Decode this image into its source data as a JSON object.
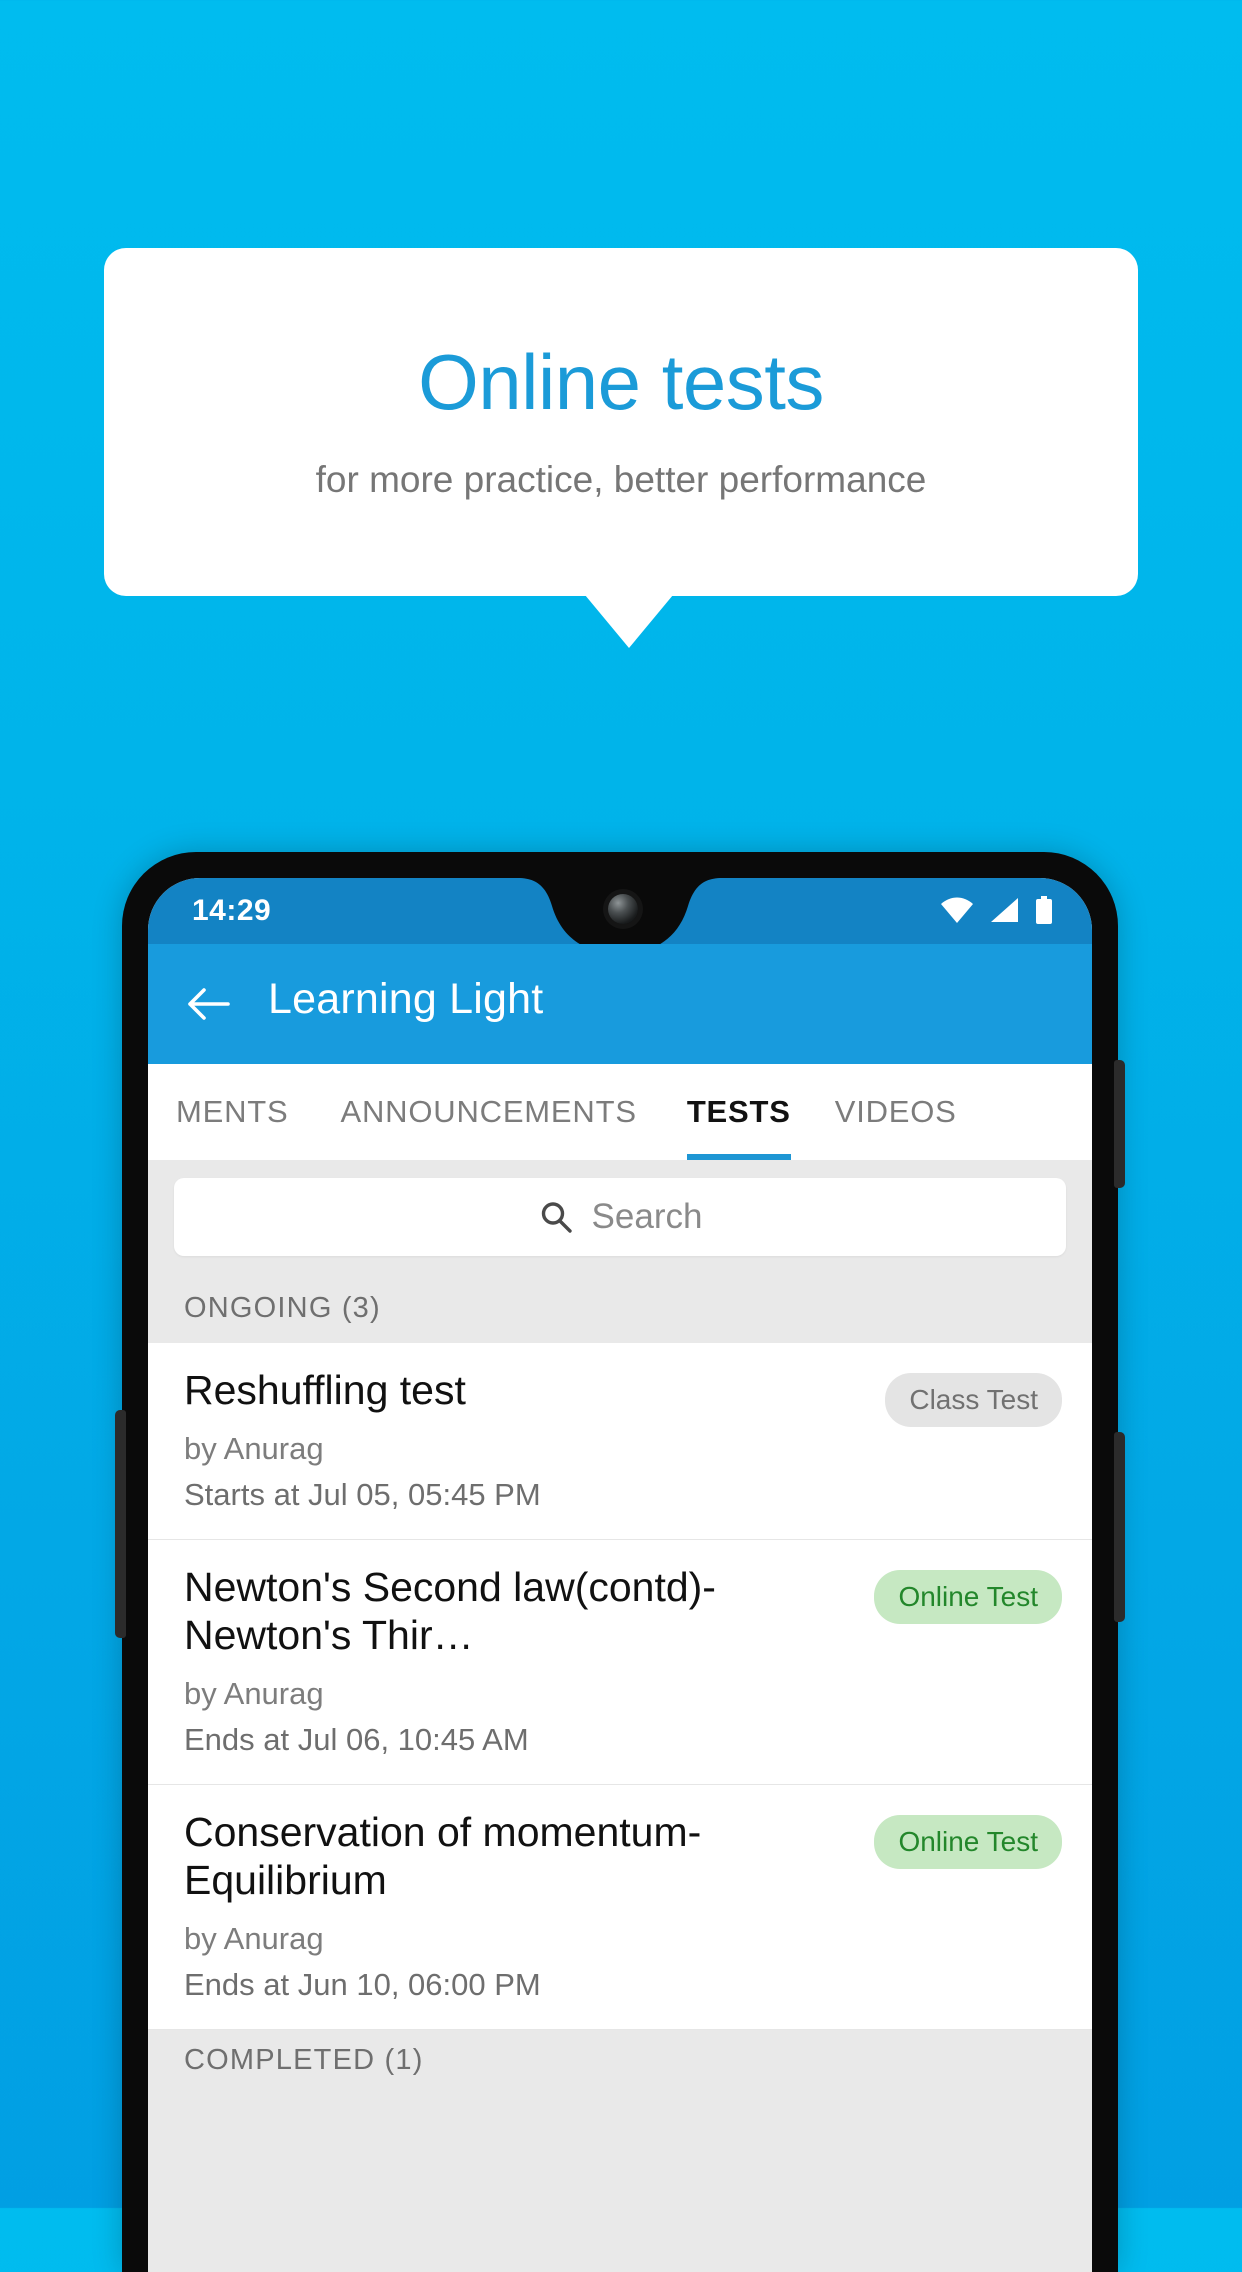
{
  "promo": {
    "title": "Online tests",
    "subtitle": "for more practice, better performance",
    "title_color": "#1B9BD8",
    "subtitle_color": "#767676"
  },
  "background": {
    "top_color": "#00BCEF",
    "bottom_color": "#019FE3"
  },
  "phone": {
    "statusbar": {
      "time": "14:29",
      "background": "#1383C4",
      "icons": [
        "wifi-icon",
        "cellular-signal-icon",
        "battery-icon"
      ]
    },
    "notch": {
      "camera": "front-camera-icon"
    },
    "appbar": {
      "back_icon": "back-arrow-icon",
      "title": "Learning Light",
      "background": "#189BDD"
    },
    "tabs": [
      {
        "label": "MENTS",
        "active": false
      },
      {
        "label": "ANNOUNCEMENTS",
        "active": false
      },
      {
        "label": "TESTS",
        "active": true
      },
      {
        "label": "VIDEOS",
        "active": false
      }
    ],
    "tab_indicator_color": "#1E96D4",
    "search": {
      "icon": "search-icon",
      "placeholder": "Search"
    },
    "sections": [
      {
        "header": "ONGOING (3)"
      },
      {
        "header": "COMPLETED (1)"
      }
    ],
    "tests": [
      {
        "title": "Reshuffling test",
        "author": "by Anurag",
        "schedule": "Starts at  Jul 05, 05:45 PM",
        "badge": "Class Test",
        "badge_type": "class",
        "badge_bg": "#E4E4E4",
        "badge_fg": "#717171"
      },
      {
        "title": "Newton's Second law(contd)-Newton's Thir…",
        "author": "by Anurag",
        "schedule": "Ends at  Jul 06, 10:45 AM",
        "badge": "Online Test",
        "badge_type": "online",
        "badge_bg": "#C6E8C2",
        "badge_fg": "#23872B"
      },
      {
        "title": "Conservation of momentum-Equilibrium",
        "author": "by Anurag",
        "schedule": "Ends at  Jun 10, 06:00 PM",
        "badge": "Online Test",
        "badge_type": "online",
        "badge_bg": "#C6E8C2",
        "badge_fg": "#23872B"
      }
    ]
  }
}
